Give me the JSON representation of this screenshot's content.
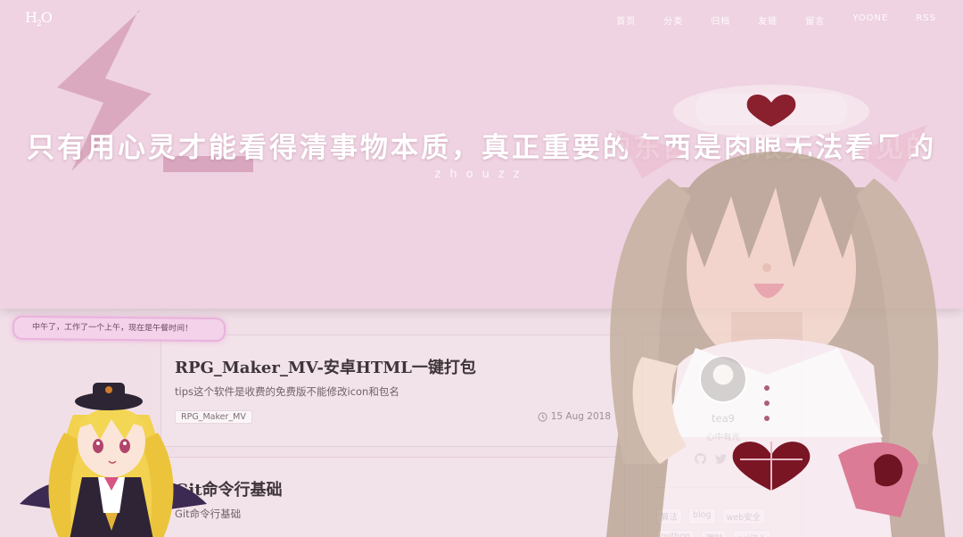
{
  "header": {
    "logo": "H",
    "logo_sub": "2",
    "logo_tail": "O",
    "nav": [
      "首页",
      "分类",
      "归档",
      "友链",
      "留言",
      "YOONE",
      "RSS"
    ],
    "title": "只有用心灵才能看得清事物本质，真正重要的东西是肉眼无法看见的",
    "subtitle": "zhouzz"
  },
  "bubble": {
    "text": "中午了，工作了一个上午，现在是午餐时间！"
  },
  "posts": [
    {
      "title": "RPG_Maker_MV-安卓HTML一键打包",
      "excerpt": "tips这个软件是收费的免费版不能修改icon和包名",
      "tag": "RPG_Maker_MV",
      "date": "15 Aug 2018"
    },
    {
      "title": "Git命令行基础",
      "excerpt": "Git命令行基础"
    }
  ],
  "sidebar": {
    "name": "tea9",
    "motto": "心中有光",
    "social_3": "简",
    "tags": [
      "算法",
      "blog",
      "web安全",
      "python",
      "理财",
      "sql注入"
    ]
  },
  "colors": {
    "background": "#f1dfe8",
    "hero": "#efd3e2",
    "accent": "#d9a6bf"
  }
}
